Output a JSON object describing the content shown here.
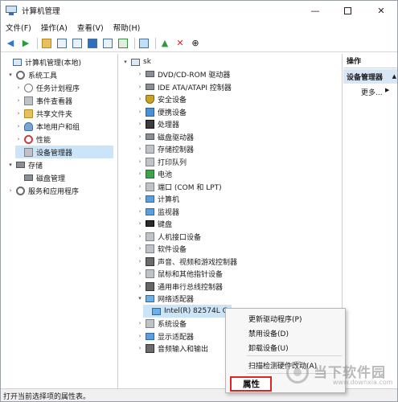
{
  "window": {
    "title": "计算机管理"
  },
  "menubar": [
    "文件(F)",
    "操作(A)",
    "查看(V)",
    "帮助(H)"
  ],
  "left_tree": [
    {
      "label": "计算机管理(本地)",
      "level": 0,
      "expander": "",
      "icon": "computer"
    },
    {
      "label": "系统工具",
      "level": 1,
      "expander": "▾",
      "icon": "gear"
    },
    {
      "label": "任务计划程序",
      "level": 2,
      "expander": "›",
      "icon": "clock"
    },
    {
      "label": "事件查看器",
      "level": 2,
      "expander": "›",
      "icon": "gray"
    },
    {
      "label": "共享文件夹",
      "level": 2,
      "expander": "›",
      "icon": "folder"
    },
    {
      "label": "本地用户和组",
      "level": 2,
      "expander": "›",
      "icon": "people"
    },
    {
      "label": "性能",
      "level": 2,
      "expander": "›",
      "icon": "red"
    },
    {
      "label": "设备管理器",
      "level": 2,
      "expander": "",
      "icon": "gray",
      "selected": true
    },
    {
      "label": "存储",
      "level": 1,
      "expander": "▾",
      "icon": "disk"
    },
    {
      "label": "磁盘管理",
      "level": 2,
      "expander": "",
      "icon": "disk"
    },
    {
      "label": "服务和应用程序",
      "level": 1,
      "expander": "›",
      "icon": "gear"
    }
  ],
  "device_tree": {
    "root": "sk",
    "items": [
      {
        "label": "DVD/CD-ROM 驱动器",
        "icon": "disk",
        "expander": "›"
      },
      {
        "label": "IDE ATA/ATAPI 控制器",
        "icon": "disk",
        "expander": "›"
      },
      {
        "label": "安全设备",
        "icon": "shield",
        "expander": "›"
      },
      {
        "label": "便携设备",
        "icon": "blue",
        "expander": "›"
      },
      {
        "label": "处理器",
        "icon": "chip",
        "expander": "›"
      },
      {
        "label": "磁盘驱动器",
        "icon": "disk",
        "expander": "›"
      },
      {
        "label": "存储控制器",
        "icon": "gray",
        "expander": "›"
      },
      {
        "label": "打印队列",
        "icon": "gray",
        "expander": "›"
      },
      {
        "label": "电池",
        "icon": "green",
        "expander": "›"
      },
      {
        "label": "端口 (COM 和 LPT)",
        "icon": "gray",
        "expander": "›"
      },
      {
        "label": "计算机",
        "icon": "monitor",
        "expander": "›"
      },
      {
        "label": "监视器",
        "icon": "monitor",
        "expander": "›"
      },
      {
        "label": "键盘",
        "icon": "dark",
        "expander": "›"
      },
      {
        "label": "人机接口设备",
        "icon": "gray",
        "expander": "›"
      },
      {
        "label": "软件设备",
        "icon": "gray",
        "expander": "›"
      },
      {
        "label": "声音、视频和游戏控制器",
        "icon": "speaker",
        "expander": "›"
      },
      {
        "label": "鼠标和其他指针设备",
        "icon": "gray",
        "expander": "›"
      },
      {
        "label": "通用串行总线控制器",
        "icon": "usb",
        "expander": "›"
      },
      {
        "label": "网络适配器",
        "icon": "net",
        "expander": "▾"
      },
      {
        "label": "Intel(R) 82574L G",
        "icon": "net",
        "expander": "",
        "child": true
      },
      {
        "label": "系统设备",
        "icon": "gray",
        "expander": "›"
      },
      {
        "label": "显示适配器",
        "icon": "monitor",
        "expander": "›"
      },
      {
        "label": "音频输入和输出",
        "icon": "speaker",
        "expander": "›"
      }
    ]
  },
  "actions": {
    "header": "操作",
    "section": "设备管理器",
    "more": "更多..."
  },
  "context_menu": {
    "items": [
      "更新驱动程序(P)",
      "禁用设备(D)",
      "卸载设备(U)",
      "扫描检测硬件改动(A)"
    ],
    "highlighted": "属性"
  },
  "statusbar": "打开当前选择项的属性表。",
  "watermark": {
    "name": "当下软件园",
    "url": "www.downxia.com"
  }
}
